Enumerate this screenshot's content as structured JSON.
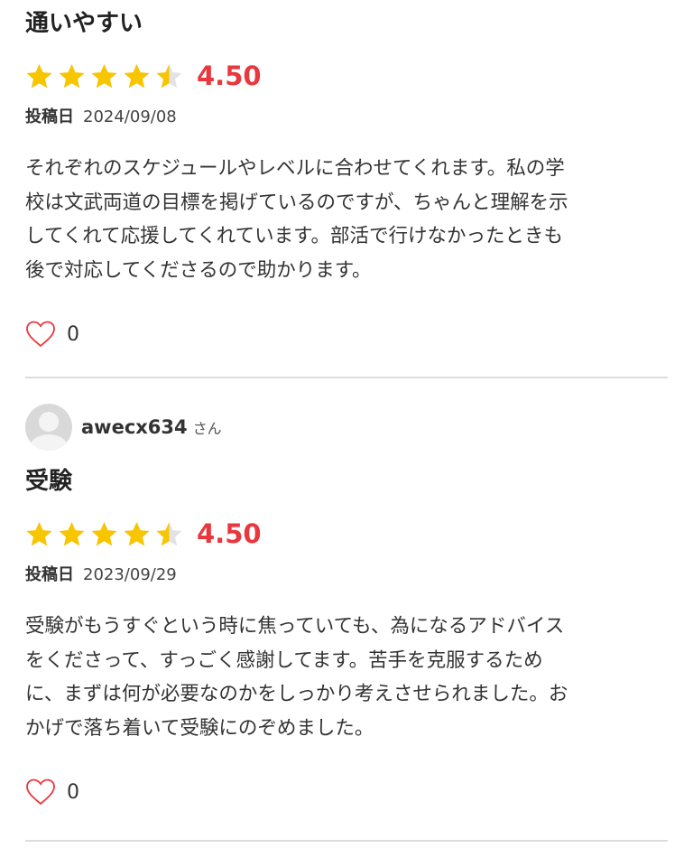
{
  "reviews": [
    {
      "reviewer": null,
      "title": "通いやすい",
      "rating": 4.5,
      "rating_text": "4.50",
      "date_label": "投稿日",
      "date": "2024/09/08",
      "body": "それぞれのスケジュールやレベルに合わせてくれます。私の学\n校は文武両道の目標を掲げているのですが、ちゃんと理解を示\nしてくれて応援してくれています。部活で行けなかったときも\n後で対応してくださるので助かります。",
      "likes": "0"
    },
    {
      "reviewer": {
        "name": "awecx634",
        "suffix": "さん"
      },
      "title": "受験",
      "rating": 4.5,
      "rating_text": "4.50",
      "date_label": "投稿日",
      "date": "2023/09/29",
      "body": "受験がもうすぐという時に焦っていても、為になるアドバイス\nをくださって、すっごく感謝してます。苦手を克服するため\nに、まずは何が必要なのかをしっかり考えさせられました。お\nかげで落ち着いて受験にのぞめました。",
      "likes": "0"
    }
  ],
  "colors": {
    "star_filled": "#f7c600",
    "star_empty": "#e3e3e3",
    "score": "#e8373d",
    "heart": "#e8373d",
    "divider": "#dddddd"
  },
  "icons": {
    "rating": "star-icon",
    "like": "heart-icon",
    "avatar": "user-avatar-icon"
  }
}
